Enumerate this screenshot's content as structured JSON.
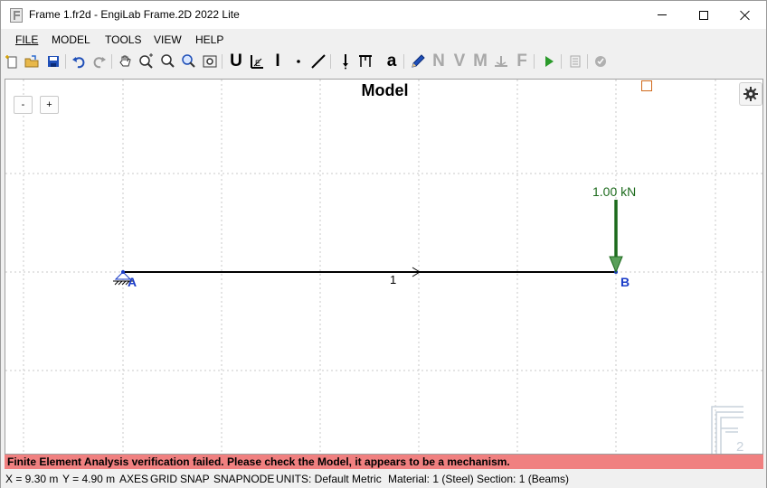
{
  "window": {
    "title": "Frame 1.fr2d - EngiLab Frame.2D 2022 Lite"
  },
  "menu": {
    "items": [
      "FILE",
      "MODEL",
      "TOOLS",
      "VIEW",
      "HELP"
    ]
  },
  "toolbar": {
    "text_buttons": {
      "nodes": "U",
      "section": "I",
      "text": "a",
      "axial": "N",
      "shear": "V",
      "moment": "M",
      "forces": "F"
    }
  },
  "canvas": {
    "title": "Model",
    "zoom_out_label": "-",
    "zoom_in_label": "+",
    "nodes": [
      {
        "label": "A",
        "x": 0,
        "y": 4.9
      },
      {
        "label": "B",
        "x": 10,
        "y": 4.9
      }
    ],
    "members": [
      {
        "label": "1"
      }
    ],
    "loads": [
      {
        "label": "1.00 kN",
        "node": "B",
        "color": "#1d6b1d"
      }
    ],
    "watermark_suffix": "2",
    "colors": {
      "node_label": "#1a3cc8",
      "load": "#1d6b1d",
      "error": "#f08080",
      "marker": "#d06a1c"
    }
  },
  "error_message": "Finite Element Analysis verification failed. Please check the Model, it appears to be a mechanism.",
  "status": {
    "x": "X = 9.30 m",
    "y": "Y = 4.90 m",
    "axes": "AXES",
    "grid": "GRID",
    "snap": "SNAP",
    "snapnode": "SNAPNODE",
    "units": "UNITS: Default Metric",
    "material": "Material: 1 (Steel)",
    "section": "Section: 1 (Beams)"
  },
  "icons": [
    "new-file-icon",
    "open-folder-icon",
    "save-icon",
    "undo-icon",
    "redo-icon",
    "pan-icon",
    "zoom-window-icon",
    "zoom-icon",
    "zoom-extents-icon",
    "zoom-all-icon",
    "node-icon",
    "beam-icon",
    "line-icon",
    "support-icon",
    "pencil-icon",
    "run-icon",
    "report-icon",
    "check-icon",
    "gear-icon"
  ]
}
